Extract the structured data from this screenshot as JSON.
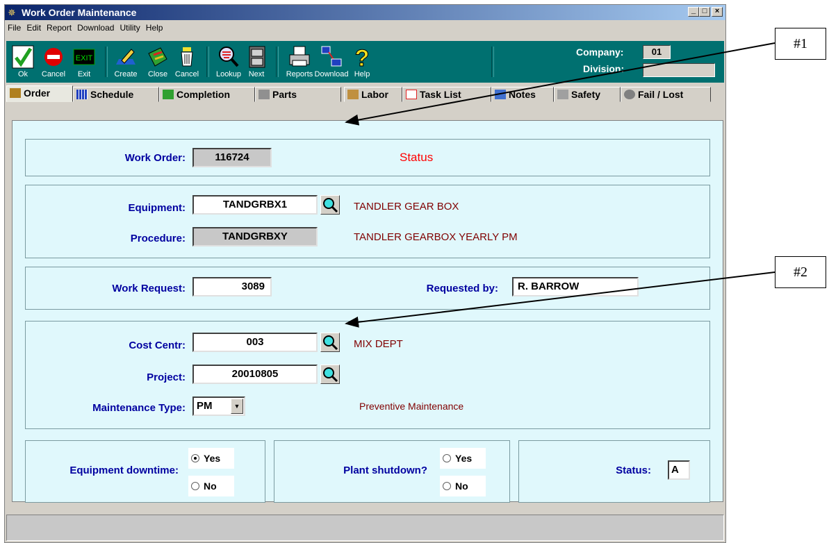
{
  "window": {
    "title": "Work Order Maintenance",
    "min": "_",
    "max": "□",
    "close": "×"
  },
  "menu": [
    "File",
    "Edit",
    "Report",
    "Download",
    "Utility",
    "Help"
  ],
  "toolbar": {
    "ok": "Ok",
    "cancel": "Cancel",
    "exit": "Exit",
    "exit_sign": "EXIT",
    "create": "Create",
    "close": "Close",
    "cancel2": "Cancel",
    "lookup": "Lookup",
    "next": "Next",
    "reports": "Reports",
    "download": "Download",
    "help": "Help",
    "company_label": "Company:",
    "company_value": "01",
    "division_label": "Division:",
    "division_value": ""
  },
  "tabs": [
    "Order",
    "Schedule",
    "Completion",
    "Parts",
    "Labor",
    "Task List",
    "Notes",
    "Safety",
    "Fail / Lost"
  ],
  "form": {
    "work_order_label": "Work Order:",
    "work_order_value": "116724",
    "status_heading": "Status",
    "equipment_label": "Equipment:",
    "equipment_value": "TANDGRBX1",
    "equipment_desc": "TANDLER GEAR BOX",
    "procedure_label": "Procedure:",
    "procedure_value": "TANDGRBXY",
    "procedure_desc": "TANDLER GEARBOX YEARLY PM",
    "work_request_label": "Work Request:",
    "work_request_value": "3089",
    "requested_by_label": "Requested by:",
    "requested_by_value": "R. BARROW",
    "cost_centr_label": "Cost Centr:",
    "cost_centr_value": "003",
    "cost_centr_desc": "MIX DEPT",
    "project_label": "Project:",
    "project_value": "20010805",
    "maint_type_label": "Maintenance Type:",
    "maint_type_value": "PM",
    "maint_type_desc": "Preventive Maintenance",
    "equip_down_label": "Equipment downtime:",
    "plant_shutdown_label": "Plant shutdown?",
    "yes": "Yes",
    "no": "No",
    "status_label": "Status:",
    "status_value": "A"
  },
  "callouts": {
    "one": "#1",
    "two": "#2"
  },
  "colors": {
    "toolbar": "#007070",
    "title_gradient_start": "#0a246a",
    "form_bg": "#e0f8fc",
    "label": "#0000a0",
    "desc": "#800000",
    "status": "#ff0000"
  }
}
